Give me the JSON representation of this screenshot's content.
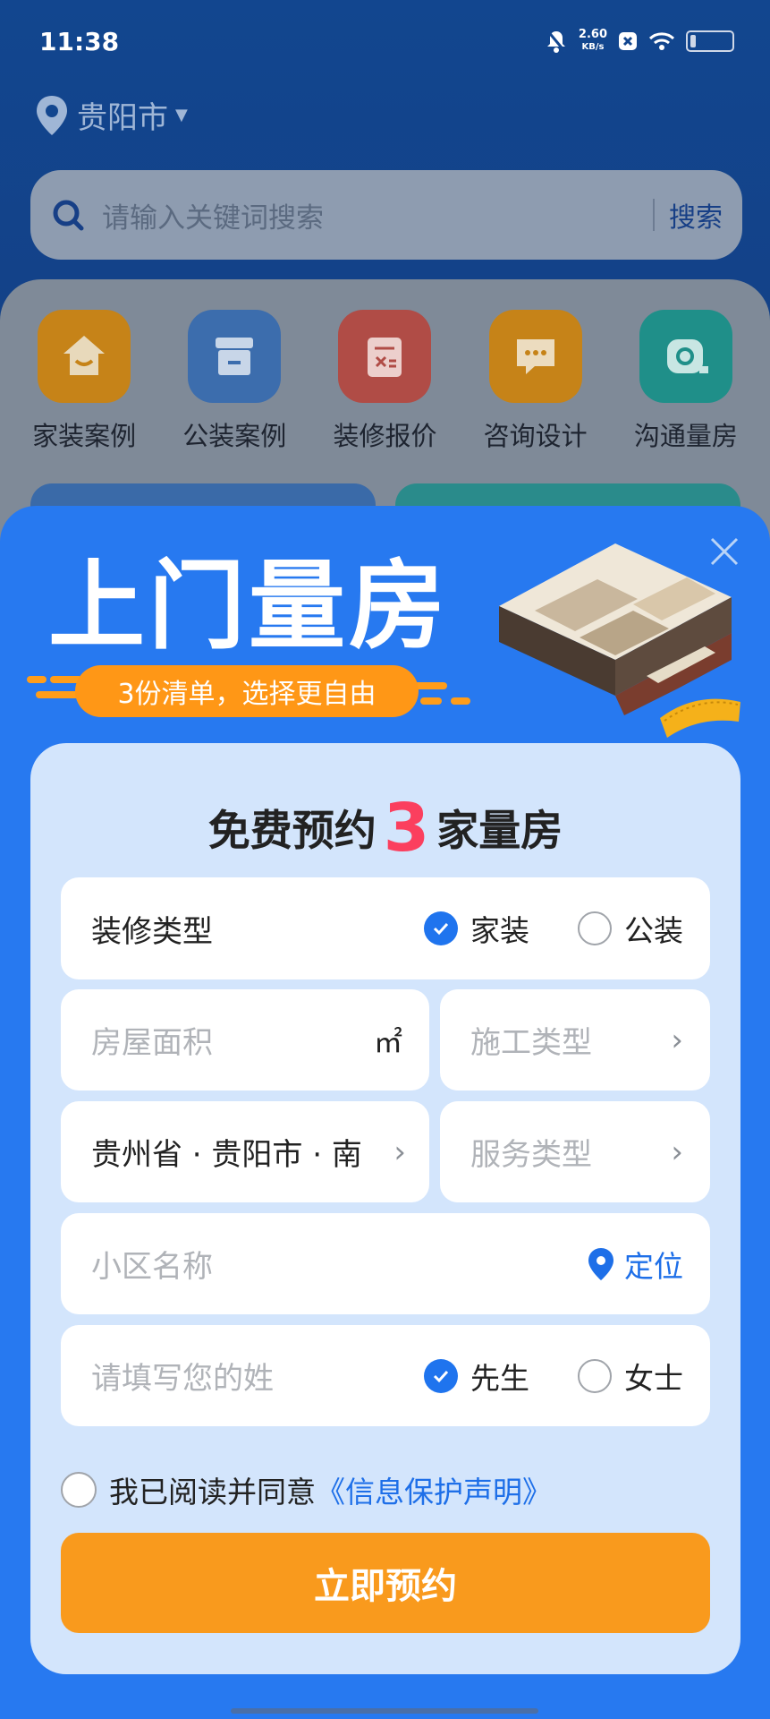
{
  "status_bar": {
    "time": "11:38",
    "net_speed_value": "2.60",
    "net_speed_unit": "KB/s"
  },
  "location": {
    "city": "贵阳市"
  },
  "search": {
    "placeholder": "请输入关键词搜索",
    "button": "搜索"
  },
  "categories": [
    {
      "label": "家装案例",
      "icon": "house-icon",
      "color": "#f7a21b"
    },
    {
      "label": "公装案例",
      "icon": "storefront-icon",
      "color": "#3b86ee"
    },
    {
      "label": "装修报价",
      "icon": "calculator-icon",
      "color": "#ef5a4f"
    },
    {
      "label": "咨询设计",
      "icon": "chat-icon",
      "color": "#f7a21b"
    },
    {
      "label": "沟通量房",
      "icon": "tape-measure-icon",
      "color": "#19b7b0"
    }
  ],
  "modal": {
    "hero_title": "上门量房",
    "hero_subtitle": "3份清单，选择更自由",
    "form_title_prefix": "免费预约",
    "form_title_count": "3",
    "form_title_suffix": "家量房",
    "decoration_type": {
      "label": "装修类型",
      "options": [
        "家装",
        "公装"
      ],
      "selected": "家装"
    },
    "area": {
      "placeholder": "房屋面积",
      "unit": "㎡"
    },
    "construction_type": {
      "placeholder": "施工类型"
    },
    "region": {
      "value": "贵州省 · 贵阳市 · 南"
    },
    "service_type": {
      "placeholder": "服务类型"
    },
    "community": {
      "placeholder": "小区名称",
      "locate_label": "定位"
    },
    "surname": {
      "placeholder": "请填写您的姓",
      "options": [
        "先生",
        "女士"
      ],
      "selected": "先生"
    },
    "agreement": {
      "text": "我已阅读并同意",
      "link": "《信息保护声明》",
      "checked": false
    },
    "submit": "立即预约"
  },
  "colors": {
    "accent": "#2779f0",
    "cta": "#f99a1d",
    "highlight": "#fb3f5e",
    "link": "#1e6fe8"
  }
}
